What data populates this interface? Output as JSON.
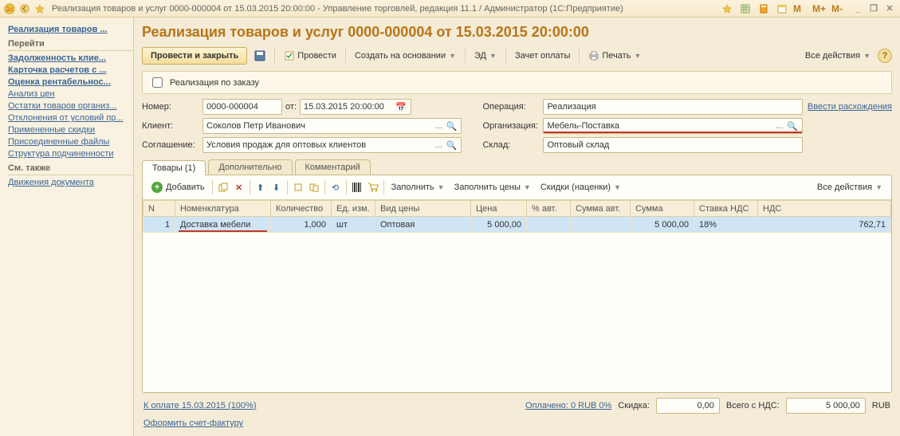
{
  "window": {
    "title": "Реализация товаров и услуг 0000-000004 от 15.03.2015 20:00:00 - Управление торговлей, редакция 11.1 / Администратор  (1С:Предприятие)"
  },
  "title_icons": {
    "m": "M",
    "mplus": "M+",
    "mminus": "M-"
  },
  "sidebar": {
    "links_top": [
      {
        "label": "Реализация товаров ...",
        "bold": true
      }
    ],
    "section1_title": "Перейти",
    "links1": [
      {
        "label": "Задолженность клие...",
        "bold": true
      },
      {
        "label": "Карточка расчетов с ...",
        "bold": true
      },
      {
        "label": "Оценка рентабельнос...",
        "bold": true
      },
      {
        "label": "Анализ цен"
      },
      {
        "label": "Остатки товаров организ..."
      },
      {
        "label": "Отклонения от условий пр..."
      },
      {
        "label": "Примененные скидки"
      },
      {
        "label": "Присоединенные файлы"
      },
      {
        "label": "Структура подчиненности"
      }
    ],
    "section2_title": "См. также",
    "links2": [
      {
        "label": "Движения документа"
      }
    ]
  },
  "page": {
    "title": "Реализация товаров и услуг 0000-000004 от 15.03.2015 20:00:00"
  },
  "toolbar": {
    "post_close": "Провести и закрыть",
    "post": "Провести",
    "create_based": "Создать на основании",
    "ed": "ЭД",
    "offset": "Зачет оплаты",
    "print": "Печать",
    "all_actions": "Все действия"
  },
  "checkbox_row": {
    "label": "Реализация по заказу"
  },
  "form": {
    "labels": {
      "number": "Номер:",
      "from": "от:",
      "operation": "Операция:",
      "client": "Клиент:",
      "organization": "Организация:",
      "agreement": "Соглашение:",
      "warehouse": "Склад:"
    },
    "values": {
      "number": "0000-000004",
      "date": "15.03.2015 20:00:00",
      "operation": "Реализация",
      "client": "Соколов Петр Иванович",
      "organization": "Мебель-Поставка",
      "agreement": "Условия продаж для оптовых клиентов",
      "warehouse": "Оптовый склад"
    },
    "link_discrepancies": "Ввести расхождения"
  },
  "tabs": [
    {
      "label": "Товары (1)",
      "active": true
    },
    {
      "label": "Дополнительно"
    },
    {
      "label": "Комментарий"
    }
  ],
  "table_toolbar": {
    "add": "Добавить",
    "fill": "Заполнить",
    "fill_prices": "Заполнить цены",
    "discounts": "Скидки (наценки)",
    "all_actions": "Все действия"
  },
  "table": {
    "columns": [
      "N",
      "Номенклатура",
      "Количество",
      "Ед. изм.",
      "Вид цены",
      "Цена",
      "% авт.",
      "Сумма авт.",
      "Сумма",
      "Ставка НДС",
      "НДС"
    ],
    "rows": [
      {
        "n": "1",
        "nom": "Доставка мебели",
        "qty": "1,000",
        "unit": "шт",
        "price_type": "Оптовая",
        "price": "5 000,00",
        "pct_auto": "",
        "sum_auto": "",
        "sum": "5 000,00",
        "vat_rate": "18%",
        "vat": "762,71"
      }
    ]
  },
  "footer": {
    "to_pay": "К оплате 15.03.2015 (100%)",
    "paid": "Оплачено: 0 RUB  0%",
    "discount_label": "Скидка:",
    "discount_value": "0,00",
    "total_label": "Всего с НДС:",
    "total_value": "5 000,00",
    "currency": "RUB",
    "invoice_link": "Оформить счет-фактуру"
  }
}
